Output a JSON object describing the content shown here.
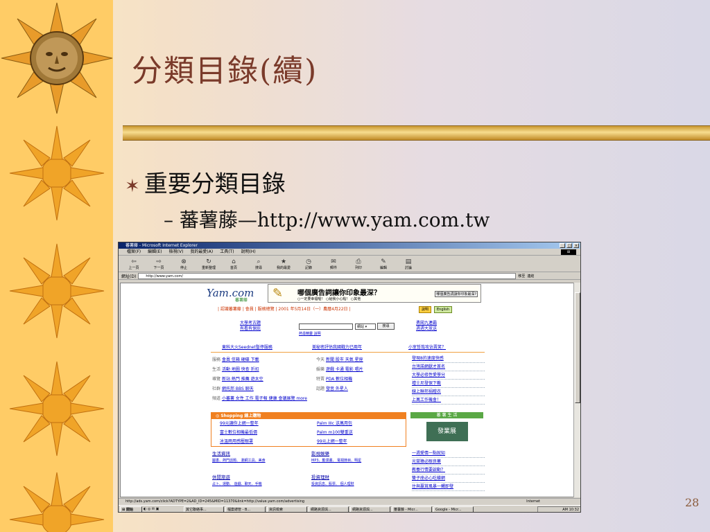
{
  "slide": {
    "title": "分類目錄(續)",
    "bullet1": "重要分類目錄",
    "bullet2": "– 蕃薯藤—http://www.yam.com.tw",
    "bullet_icon": "star-bullet-icon",
    "page_number": "28"
  },
  "browser": {
    "window_title": "蕃薯藤 - Microsoft Internet Explorer",
    "menu": [
      "檔案(F)",
      "編輯(E)",
      "檢視(V)",
      "我的最愛(A)",
      "工具(T)",
      "說明(H)"
    ],
    "toolbar": [
      "上一頁",
      "下一頁",
      "停止",
      "重新整理",
      "首頁",
      "搜尋",
      "我的最愛",
      "記錄",
      "郵件",
      "列印",
      "編輯",
      "討論"
    ],
    "address_label": "網址(D)",
    "address": "http://www.yam.com/",
    "go": "移至",
    "links": "連結",
    "status_url": "http://ads.yam.com/click?ADTYPE=2&AD_ID=245&MID=11370&link=http://value.yam.com/advertising",
    "status_zone": "Internet"
  },
  "yam": {
    "logo": "Yam.com",
    "logo_sub": "蕃薯藤",
    "ad_title": "哪個廣告詞讓你印象最深？",
    "ad_sub": "○一定要幸福喔！ ○給我小心點！ ○其他",
    "ad_q": "哪個廣告詞讓你印象最深?",
    "topbar": "| 認識蕃薯藤 | 會員 | 服務總覽 | 2001 年5月14日（一）農曆4月22日 |",
    "left_promo1": "大學考古題",
    "left_promo2": "有看有保庇",
    "search_select": "網站",
    "search_button": "搜尋",
    "search_links": "熱尋精靈  說明",
    "right_promo1": "勇闖九連霸",
    "right_promo2": "週週大放送",
    "headline1": "東科大火Seednet暫停服務",
    "headline2": "美秘密評估我國戰力已兩年",
    "headline3": "小室哲哉攻佔賣笑？",
    "cat_rows": [
      {
        "label": "服務",
        "links": "會員 信箱 硬碟 下載"
      },
      {
        "label": "生活",
        "links": "活動 地圖 快查 折扣"
      },
      {
        "label": "導覽",
        "links": "新站 熱門 推薦 遊太空"
      },
      {
        "label": "社群",
        "links": "網托邦 BBS 聊天"
      },
      {
        "label": "頻道",
        "links": "小蕃薯 女性 工作 電子報 健康 會議展覽 more"
      }
    ],
    "mid_rows": [
      {
        "label": "今天",
        "links": "新聞 股市 天氣 星座"
      },
      {
        "label": "娛樂",
        "links": "遊戲 卡通 電影 唱片"
      },
      {
        "label": "特賣",
        "links": "PDA 數位相機"
      },
      {
        "label": "話題",
        "links": "發音 外星人"
      }
    ],
    "right_list": [
      "發現8的速度快感",
      "台灣諾網獻才首名",
      "大學必修性愛學分",
      "禮士尼發保下載",
      "線上聯邦捐贈衣",
      "上萬工作機會！"
    ],
    "shopping_header": "◎ Shopping 線上購物",
    "shopping_left": [
      "99元讓你上網一整年",
      "富士數位相機最低價",
      "冰溫雨用感壓眼罩"
    ],
    "shopping_right": [
      "Palm IIIc 送萬用包",
      "Palm m100雙重送",
      "99元上網一整年"
    ],
    "life_header": "蕃 薯 生 活",
    "life_pic": "發業展",
    "sections": [
      {
        "title": "生活資訊",
        "links": "圖書、熱門話題、 瀏網工具、美食"
      },
      {
        "title": "影視娛樂",
        "links": "MP3、動漫畫、 電視節目、明星"
      },
      {
        "title": "休閒旅遊",
        "links": "占卜、運動、 遊戲、聊天、手機"
      },
      {
        "title": "投資理財",
        "links": "投資訊息、股票、 個人理財"
      }
    ],
    "right_list2": [
      "一週愛情一點就知",
      "光棠猿必眼良藥",
      "教養行情要啟動？",
      "雙子座必心吃蠔網",
      "住與贏賞風暴一觸即發"
    ]
  },
  "taskbar": {
    "start": "開始",
    "tasks": [
      "其它聯絡事...",
      "檔案總管 - B...",
      "資訊檢索",
      "網路資源與...",
      "網路資源與...",
      "蕃薯藤 - Micr...",
      "Google - Micr..."
    ],
    "clock": "AM 10:32"
  }
}
